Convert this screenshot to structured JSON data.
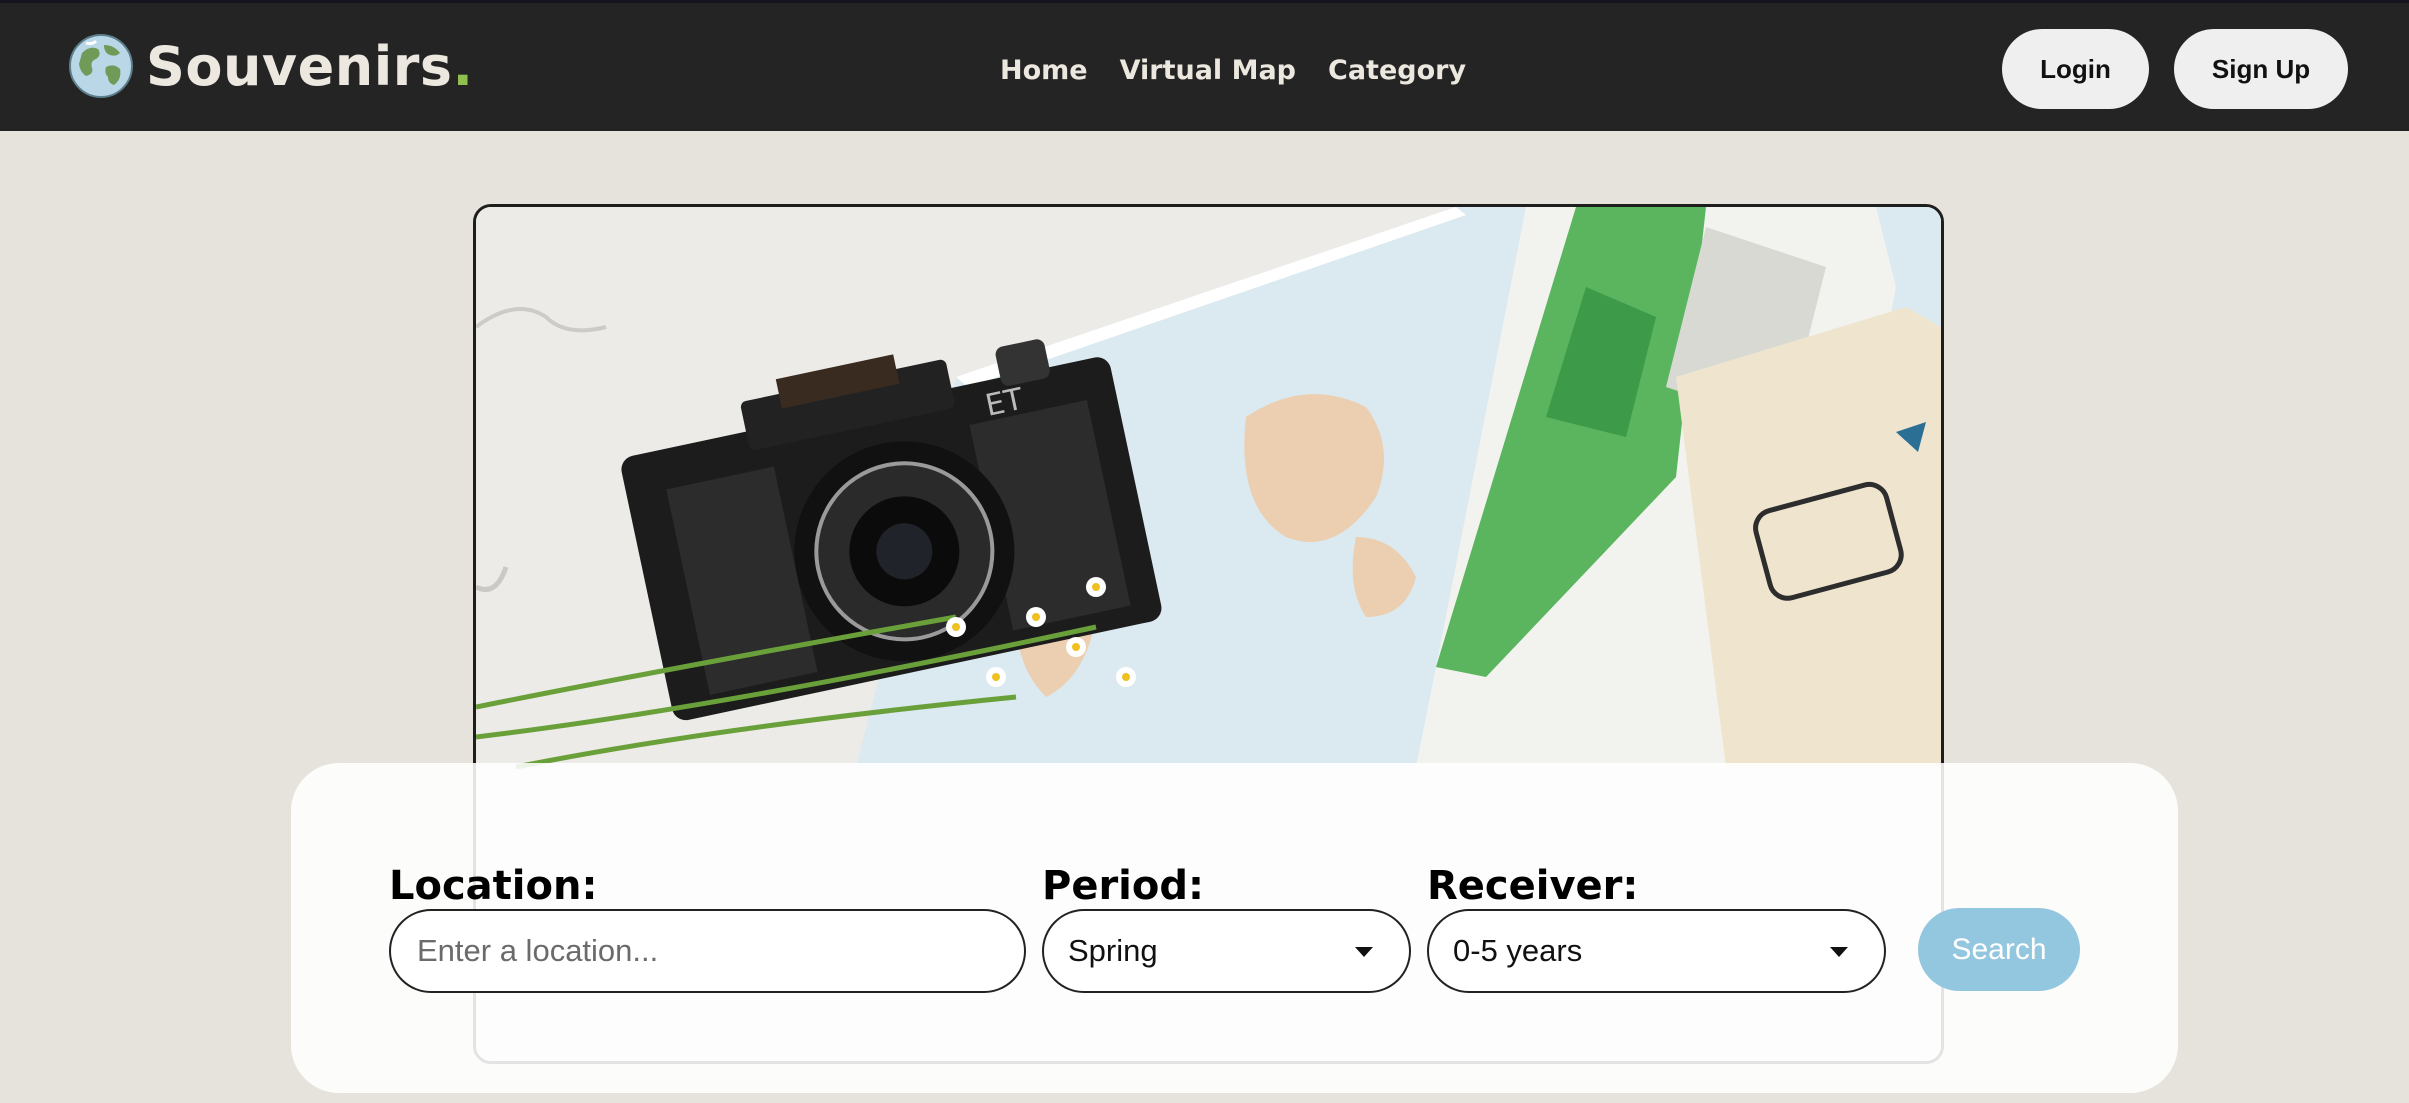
{
  "navbar": {
    "brand_name": "Souvenirs",
    "brand_dot": ".",
    "links": [
      "Home",
      "Virtual Map",
      "Category"
    ],
    "login_label": "Login",
    "signup_label": "Sign Up",
    "logo_icon": "globe-icon"
  },
  "hero": {
    "image": "travel-flatlay-camera-map-passport"
  },
  "search": {
    "location_label": "Location:",
    "location_placeholder": "Enter a location...",
    "location_value": "",
    "period_label": "Period:",
    "period_value": "Spring",
    "receiver_label": "Receiver:",
    "receiver_value": "0-5 years",
    "button_label": "Search"
  },
  "colors": {
    "navbar_bg": "#242424",
    "page_bg": "#e6e3dc",
    "brand_accent": "#8fbf4f",
    "search_button": "#93c7df"
  }
}
